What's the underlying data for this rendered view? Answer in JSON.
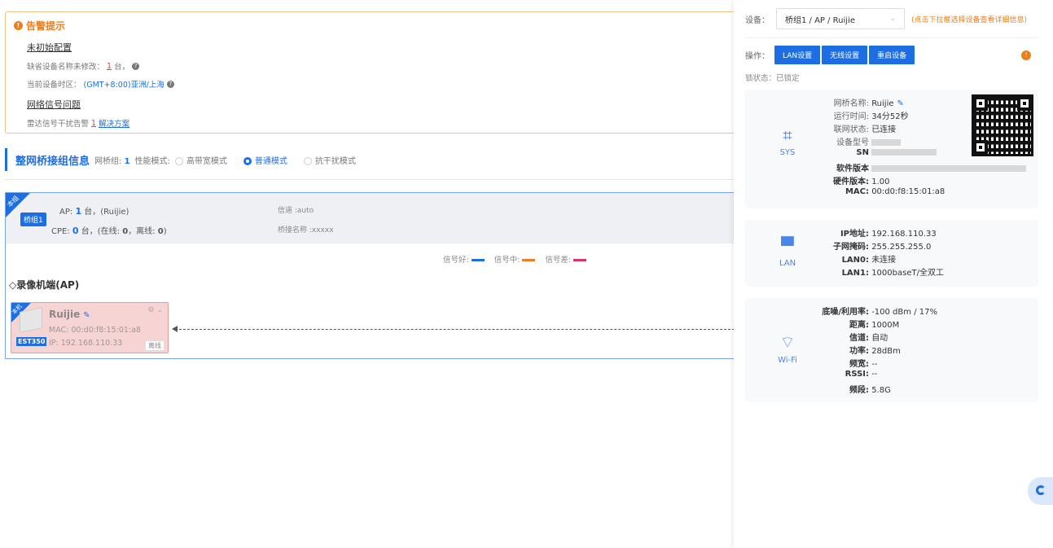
{
  "alert": {
    "title": "告警提示",
    "section1": "未初始配置",
    "line1_label": "缺省设备名称未修改：",
    "line1_count": "1",
    "line1_unit": "台，",
    "line2_label": "当前设备时区：",
    "line2_value": "(GMT+8:00)亚洲/上海",
    "section2": "网络信号问题",
    "line3_label": "雷达信号干扰告警",
    "line3_count": "1",
    "line3_link": "解决方案"
  },
  "group_header": {
    "title": "整网桥接组信息",
    "group_label": "网桥组:",
    "group_count": "1",
    "mode_label": "性能模式:",
    "modes": [
      "高带宽模式",
      "普通模式",
      "抗干扰模式"
    ],
    "selected_mode": "普通模式"
  },
  "group": {
    "ribbon": "本组",
    "tag": "桥组1",
    "ap_prefix": "AP:",
    "ap_count": "1",
    "ap_suffix": "台，(Ruijie)",
    "cpe_prefix": "CPE:",
    "cpe_count": "0",
    "cpe_mid": "台，(在线:",
    "cpe_online": "0",
    "cpe_offline_label": "，离线:",
    "cpe_offline": "0",
    "cpe_close": ")",
    "channel": "信道 :auto",
    "bridge_name": "桥接名称 :xxxxx"
  },
  "legend": {
    "good": "信号好:",
    "mid": "信号中:",
    "bad": "信号差:",
    "colors": {
      "good": "#1d6ee3",
      "mid": "#ee7e1c",
      "bad": "#e0306a"
    }
  },
  "ap_section": {
    "label": "◇录像机端(AP)"
  },
  "device": {
    "ribbon": "本机",
    "name": "Ruijie",
    "mac": "MAC:  00:d0:f8:15:01:a8",
    "ip": "IP:  192.168.110.33",
    "model": "EST350",
    "status": "离线"
  },
  "side": {
    "device_label": "设备：",
    "device_select": "桥组1 / AP / Ruijie",
    "device_hint": "(点击下拉框选择设备查看详细信息)",
    "ops_label": "操作：",
    "buttons": [
      "LAN设置",
      "无线设置",
      "重启设备"
    ],
    "lock_status": "锁状态：已锁定",
    "sys": {
      "icon_label": "SYS",
      "bridge_name_k": "网桥名称:",
      "bridge_name_v": "Ruijie",
      "uptime_k": "运行时间:",
      "uptime_v": "34分52秒",
      "net_k": "联网状态:",
      "net_v": "已连接",
      "model_k": "设备型号",
      "sn_k": "SN",
      "sw_k": "软件版本",
      "hw_k": "硬件版本:",
      "hw_v": "1.00",
      "mac_k": "MAC:",
      "mac_v": "00:d0:f8:15:01:a8"
    },
    "lan": {
      "icon_label": "LAN",
      "ip_k": "IP地址:",
      "ip_v": "192.168.110.33",
      "mask_k": "子网掩码:",
      "mask_v": "255.255.255.0",
      "lan0_k": "LAN0:",
      "lan0_v": "未连接",
      "lan1_k": "LAN1:",
      "lan1_v": "1000baseT/全双工"
    },
    "wifi": {
      "icon_label": "Wi-Fi",
      "noise_k": "底噪/利用率:",
      "noise_v": "-100 dBm / 17%",
      "dist_k": "距离:",
      "dist_v": "1000M",
      "ch_k": "信道:",
      "ch_v": "自动",
      "power_k": "功率:",
      "power_v": "28dBm",
      "bw_k": "频宽:",
      "bw_v": "--",
      "rssi_k": "RSSI:",
      "rssi_v": "--",
      "band_k": "频段:",
      "band_v": "5.8G"
    }
  }
}
